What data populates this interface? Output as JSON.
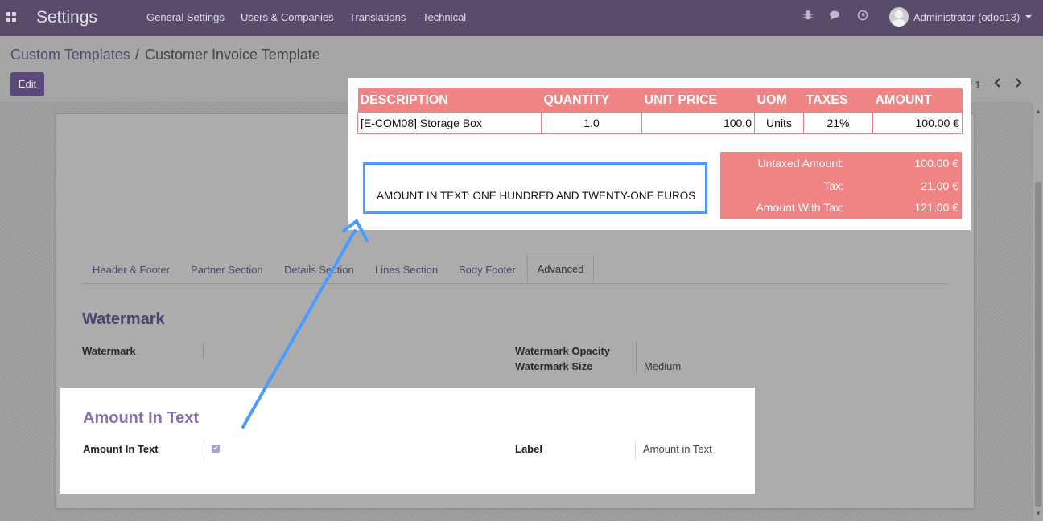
{
  "header": {
    "app_title": "Settings",
    "menu": [
      "General Settings",
      "Users & Companies",
      "Translations",
      "Technical"
    ],
    "user": "Administrator (odoo13)",
    "icons": [
      "apps-icon",
      "bug-icon",
      "chat-icon",
      "clock-icon"
    ]
  },
  "control_panel": {
    "breadcrumb_parent": "Custom Templates",
    "breadcrumb_sep": "/",
    "breadcrumb_current": "Customer Invoice Template",
    "edit_label": "Edit",
    "pager": "/ 1"
  },
  "tabs": [
    "Header & Footer",
    "Partner Section",
    "Details Section",
    "Lines Section",
    "Body Footer",
    "Advanced"
  ],
  "watermark": {
    "title": "Watermark",
    "watermark_label": "Watermark",
    "opacity_label": "Watermark Opacity",
    "size_label": "Watermark Size",
    "size_value": "Medium"
  },
  "amount_in_text": {
    "title": "Amount In Text",
    "field_label": "Amount In Text",
    "checked": true,
    "label_label": "Label",
    "label_value": "Amount in Text"
  },
  "invoice_preview": {
    "columns": [
      "DESCRIPTION",
      "QUANTITY",
      "UNIT PRICE",
      "UOM",
      "TAXES",
      "AMOUNT"
    ],
    "row": [
      "[E-COM08] Storage Box",
      "1.0",
      "100.0",
      "Units",
      "21%",
      "100.00 €"
    ],
    "totals": [
      {
        "label": "Untaxed Amount",
        "colon": ":",
        "value": "100.00 €"
      },
      {
        "label": "Tax",
        "colon": ":",
        "value": "21.00 €"
      },
      {
        "label": "Amount With Tax",
        "colon": ":",
        "value": "121.00 €"
      }
    ],
    "amount_text": "AMOUNT IN TEXT: ONE HUNDRED AND TWENTY-ONE EUROS"
  },
  "colors": {
    "navbar": "#584c6a",
    "accent": "#8a6fb0",
    "invoice_header": "#f08383",
    "highlight_box": "#4a9cff"
  }
}
